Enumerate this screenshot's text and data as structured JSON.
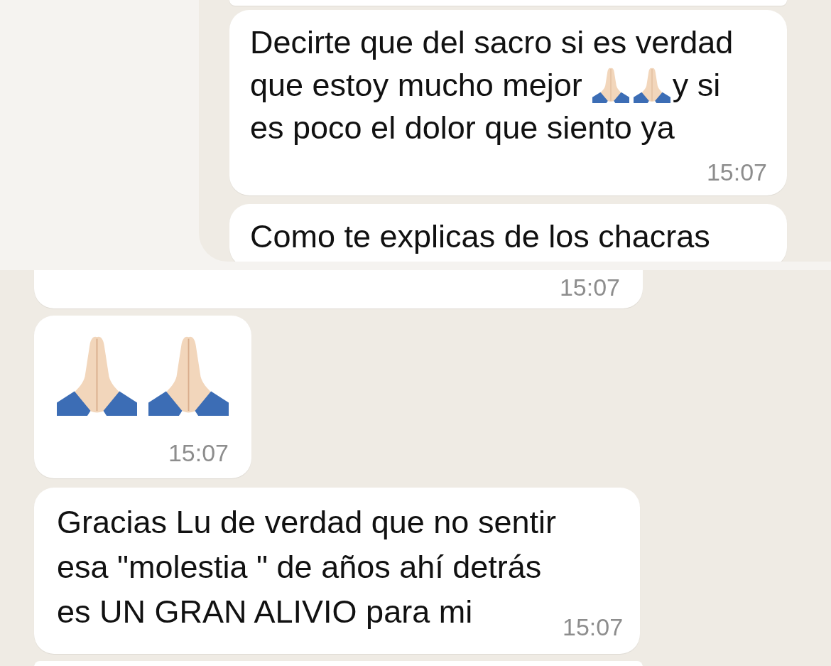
{
  "top_screenshot": {
    "messages": [
      {
        "kind": "clipped"
      },
      {
        "kind": "text",
        "lines": [
          [
            {
              "kind": "text",
              "text": "Decirte que del sacro si es verdad"
            }
          ],
          [
            {
              "kind": "text",
              "text": "que estoy mucho mejor"
            },
            {
              "kind": "emoji"
            },
            {
              "kind": "emoji"
            },
            {
              "kind": "text",
              "text": "y si"
            }
          ],
          [
            {
              "kind": "text",
              "text": "es poco el dolor que siento ya"
            }
          ]
        ],
        "time": "15:07"
      },
      {
        "kind": "text",
        "lines": [
          [
            {
              "kind": "text",
              "text": "Como te explicas de los chacras"
            }
          ]
        ]
      }
    ]
  },
  "bottom_screenshot": {
    "messages": [
      {
        "kind": "text",
        "time": "15:07"
      },
      {
        "kind": "emoji_only",
        "lines": [
          [
            {
              "kind": "emoji"
            },
            {
              "kind": "emoji"
            }
          ]
        ],
        "time": "15:07"
      },
      {
        "kind": "text",
        "text": "Gracias Lu de verdad que no sentir esa \"molestia \" de años ahí detrás es UN GRAN ALIVIO para mi",
        "time": "15:07"
      },
      {
        "kind": "clipped"
      }
    ]
  }
}
